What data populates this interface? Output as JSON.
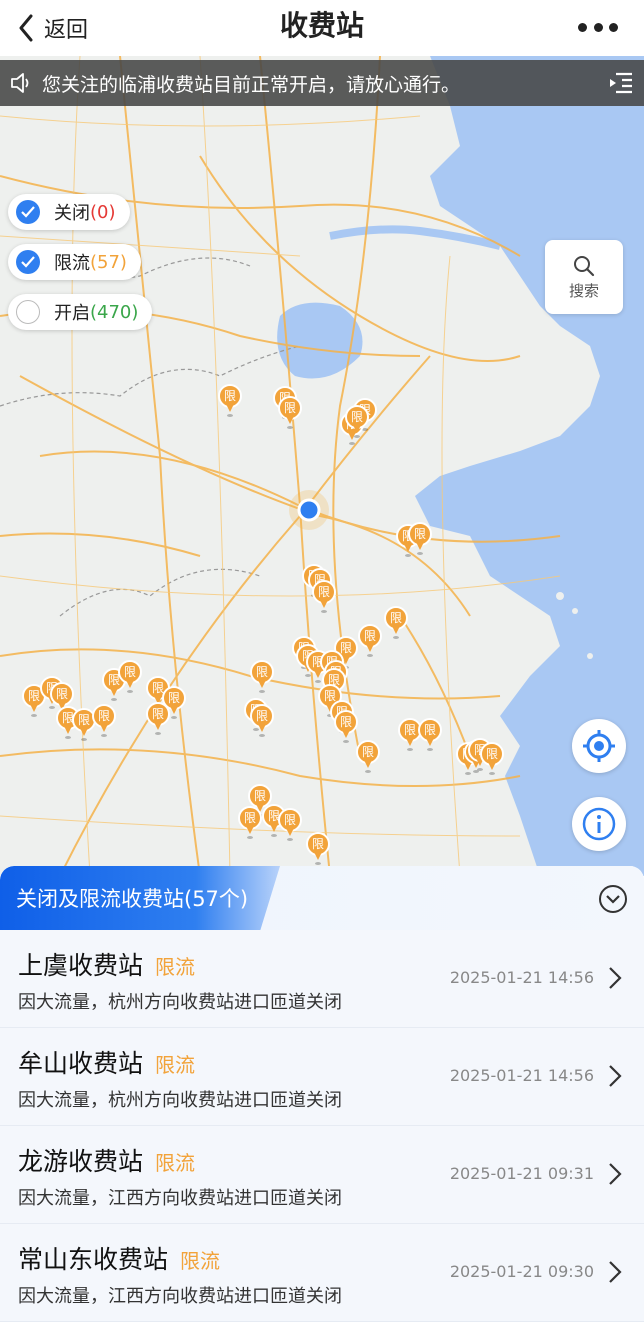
{
  "header": {
    "back_label": "返回",
    "title": "收费站"
  },
  "notice": {
    "text": "您关注的临浦收费站目前正常开启，请放心通行。"
  },
  "filters": [
    {
      "label": "关闭",
      "count": "(0)",
      "checked": true,
      "color": "#e53935"
    },
    {
      "label": "限流",
      "count": "(57)",
      "checked": true,
      "color": "#f2a33a"
    },
    {
      "label": "开启",
      "count": "(470)",
      "checked": false,
      "color": "#3aa64a"
    }
  ],
  "map": {
    "search_label": "搜索",
    "pin_label": "限",
    "colors": {
      "land": "#eef0ee",
      "water": "#a9c8f3",
      "road": "#f5b24a",
      "accent": "#2f7ff0",
      "pin": "#f2a33a"
    }
  },
  "panel": {
    "tab_title": "关闭及限流收费站(57个)",
    "items": [
      {
        "name": "上虞收费站",
        "status": "限流",
        "reason": "因大流量，杭州方向收费站进口匝道关闭",
        "time": "2025-01-21 14:56"
      },
      {
        "name": "牟山收费站",
        "status": "限流",
        "reason": "因大流量，杭州方向收费站进口匝道关闭",
        "time": "2025-01-21 14:56"
      },
      {
        "name": "龙游收费站",
        "status": "限流",
        "reason": "因大流量，江西方向收费站进口匝道关闭",
        "time": "2025-01-21 09:31"
      },
      {
        "name": "常山东收费站",
        "status": "限流",
        "reason": "因大流量，江西方向收费站进口匝道关闭",
        "time": "2025-01-21 09:30"
      }
    ]
  }
}
